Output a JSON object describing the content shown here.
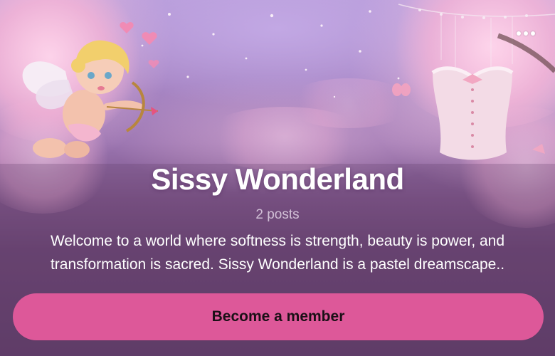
{
  "header": {
    "menu_icon": "more-horizontal-icon"
  },
  "profile": {
    "title": "Sissy Wonderland",
    "post_count": "2 posts",
    "description": "Welcome to a world where softness is strength, beauty is power, and transformation is sacred. Sissy Wonderland is a pastel dreamscape.."
  },
  "actions": {
    "member_button_label": "Become a member"
  },
  "colors": {
    "accent": "#dd5899",
    "background_bottom": "#5f3d68",
    "text": "#ffffff"
  }
}
